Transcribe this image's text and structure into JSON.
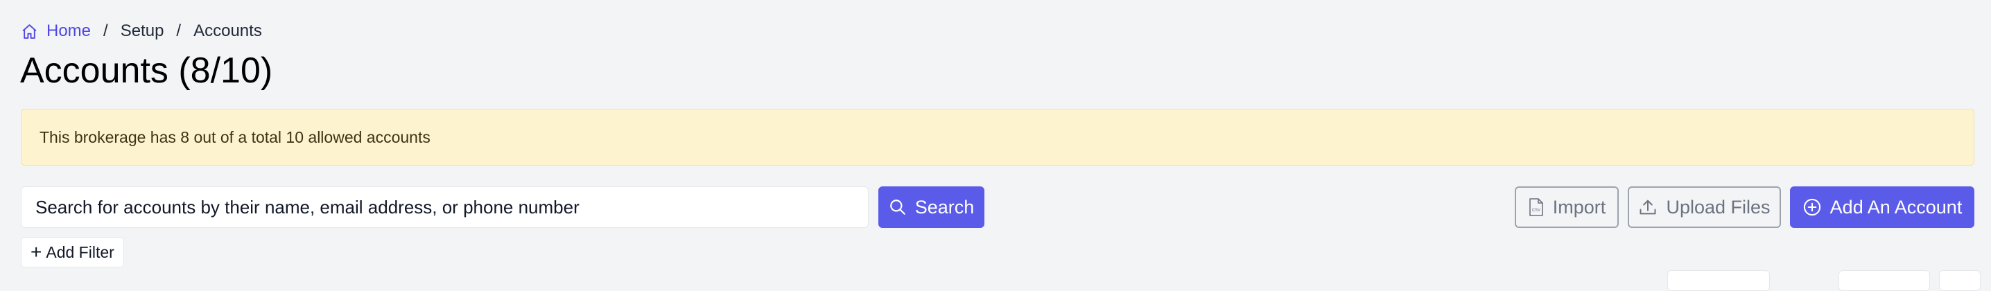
{
  "breadcrumb": {
    "items": [
      "Home",
      "Setup",
      "Accounts"
    ],
    "separator": "/"
  },
  "page": {
    "title": "Accounts (8/10)"
  },
  "alert": {
    "message": "This brokerage has 8 out of a total 10 allowed accounts"
  },
  "search": {
    "placeholder": "Search for accounts by their name, email address, or phone number",
    "button_label": "Search"
  },
  "actions": {
    "import_label": "Import",
    "upload_label": "Upload Files",
    "add_account_label": "Add An Account"
  },
  "filters": {
    "add_filter_label": "Add Filter",
    "add_filter_icon": "+"
  },
  "colors": {
    "primary": "#5b5bea",
    "link": "#4f46e5",
    "alert_bg": "#fdf3cf",
    "page_bg": "#f3f4f6"
  },
  "icons": {
    "home": "home-icon",
    "search": "search-icon",
    "import": "csv-file-icon",
    "upload": "upload-icon",
    "add": "plus-circle-icon"
  }
}
